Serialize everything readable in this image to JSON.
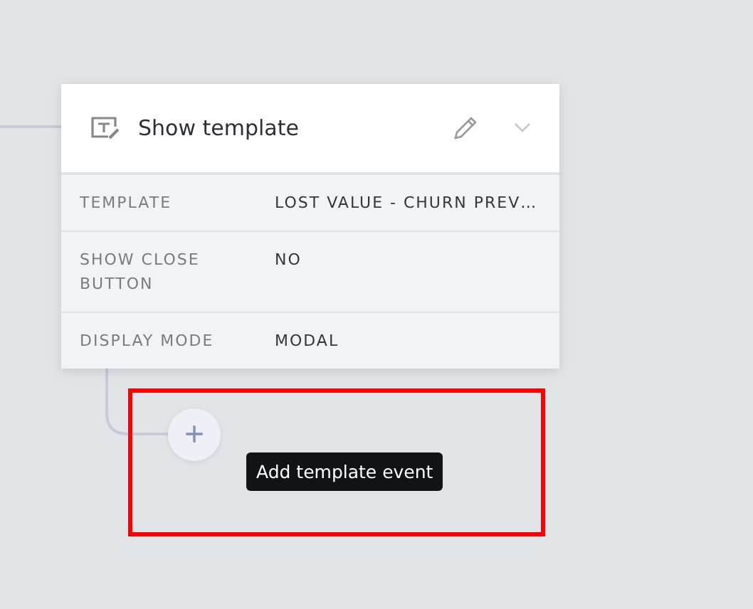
{
  "card": {
    "title": "Show template",
    "expanded": false,
    "rows": [
      {
        "label": "TEMPLATE",
        "value": "LOST VALUE - CHURN PREV…"
      },
      {
        "label": "SHOW CLOSE BUTTON",
        "value": "NO"
      },
      {
        "label": "DISPLAY MODE",
        "value": "MODAL"
      }
    ]
  },
  "add_button": {
    "label": "+"
  },
  "tooltip": "Add template event",
  "highlight_box": true
}
